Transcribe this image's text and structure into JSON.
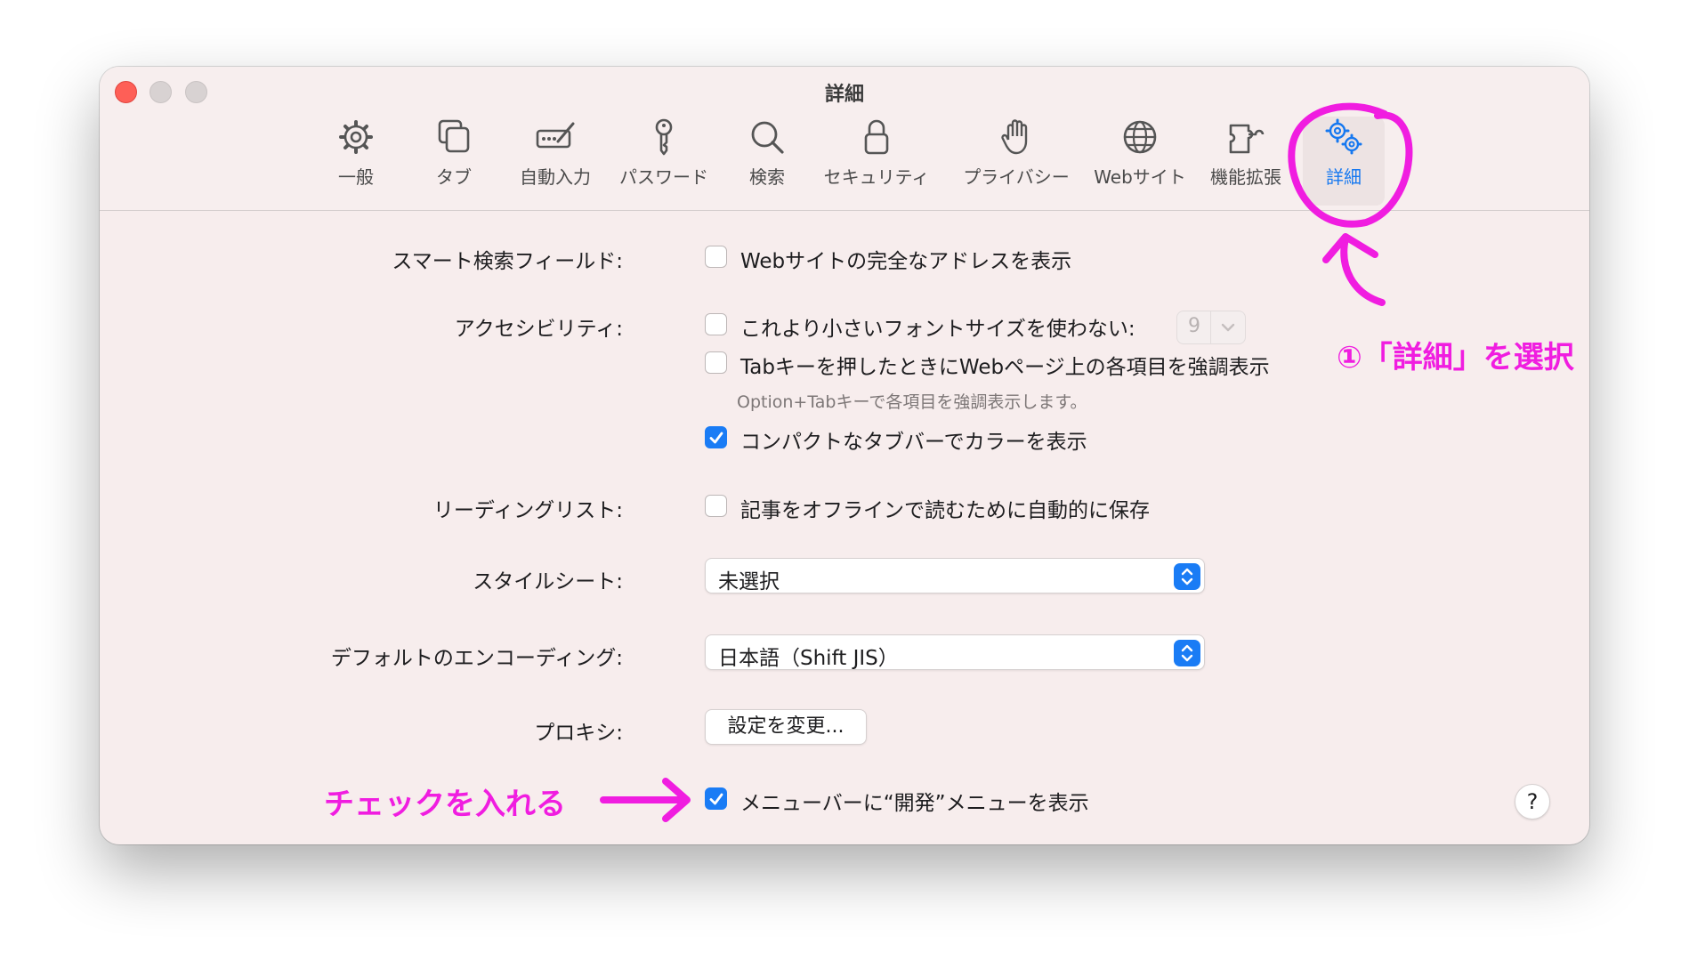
{
  "window": {
    "title": "詳細"
  },
  "toolbar": {
    "tabs": [
      {
        "label": "一般",
        "icon": "gear-icon"
      },
      {
        "label": "タブ",
        "icon": "tabs-icon"
      },
      {
        "label": "自動入力",
        "icon": "pencil-field-icon"
      },
      {
        "label": "パスワード",
        "icon": "key-icon"
      },
      {
        "label": "検索",
        "icon": "magnifier-icon"
      },
      {
        "label": "セキュリティ",
        "icon": "lock-icon"
      },
      {
        "label": "プライバシー",
        "icon": "hand-icon"
      },
      {
        "label": "Webサイト",
        "icon": "globe-icon"
      },
      {
        "label": "機能拡張",
        "icon": "puzzle-icon"
      },
      {
        "label": "詳細",
        "icon": "gears-icon",
        "selected": true
      }
    ]
  },
  "settings": {
    "smart_search": {
      "label": "スマート検索フィールド:",
      "option": "Webサイトの完全なアドレスを表示",
      "checked": false
    },
    "accessibility": {
      "label": "アクセシビリティ:",
      "min_font_option": "これより小さいフォントサイズを使わない:",
      "min_font_checked": false,
      "min_font_value": "9",
      "tab_option": "Tabキーを押したときにWebページ上の各項目を強調表示",
      "tab_checked": false,
      "tab_hint": "Option+Tabキーで各項目を強調表示します。",
      "compact_option": "コンパクトなタブバーでカラーを表示",
      "compact_checked": true
    },
    "reading_list": {
      "label": "リーディングリスト:",
      "option": "記事をオフラインで読むために自動的に保存",
      "checked": false
    },
    "stylesheet": {
      "label": "スタイルシート:",
      "value": "未選択"
    },
    "encoding": {
      "label": "デフォルトのエンコーディング:",
      "value": "日本語（Shift JIS）"
    },
    "proxy": {
      "label": "プロキシ:",
      "button": "設定を変更..."
    },
    "develop_menu": {
      "option": "メニューバーに“開発”メニューを表示",
      "checked": true
    },
    "help_label": "?"
  },
  "annotations": {
    "select_details": "①「詳細」を選択",
    "check_it": "チェックを入れる",
    "color": "#f01de0"
  },
  "colors": {
    "accent": "#1a7cf5",
    "close_button": "#fe5f57"
  }
}
